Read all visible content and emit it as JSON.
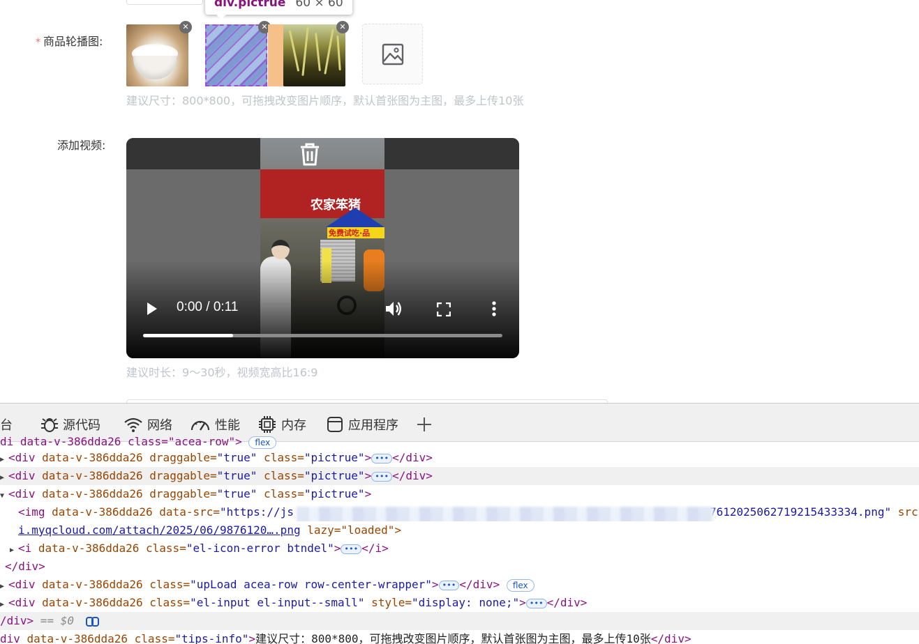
{
  "form": {
    "carousel_label": "商品轮播图:",
    "carousel_required": "*",
    "carousel_tip": "建议尺寸：800*800，可拖拽改变图片顺序，默认首张图为主图，最多上传10张",
    "video_label": "添加视频:",
    "video_tip": "建议时长：9～30秒，视频宽高比16:9"
  },
  "tooltip": {
    "tag": "div.pictrue",
    "size": "60 × 60"
  },
  "images": [
    {
      "name": "rice-bowl",
      "delete_icon": "close-icon"
    },
    {
      "name": "fabric",
      "delete_icon": "close-icon"
    },
    {
      "name": "rice-plant",
      "delete_icon": "close-icon"
    }
  ],
  "upload": {
    "icon": "image-icon"
  },
  "video": {
    "time": "0:00 / 0:11",
    "progress": 0.25,
    "sign_text": "农家笨猪",
    "banner_text": "免费试吃·品"
  },
  "devtools": {
    "tabs": [
      {
        "label": "台",
        "icon": "console-icon"
      },
      {
        "label": "源代码",
        "icon": "bug-icon"
      },
      {
        "label": "网络",
        "icon": "wifi-icon"
      },
      {
        "label": "性能",
        "icon": "gauge-icon"
      },
      {
        "label": "内存",
        "icon": "chip-icon"
      },
      {
        "label": "应用程序",
        "icon": "window-icon"
      },
      {
        "label": "+",
        "icon": "plus-icon"
      }
    ],
    "lines": {
      "l0": "di  data-v-386dda26 class=\"acea-row\">",
      "l0_badge": "flex",
      "div_open": "<div",
      "attr_v": " data-v-386dda26",
      "attr_drag": " draggable=",
      "val_true": "\"true\"",
      "attr_class": " class=",
      "val_pictrue": "\"pictrue\"",
      "gt": ">",
      "close_div": "</div>",
      "img_open": "<img",
      "attr_datasrc": " data-src=",
      "val_datasrc_start": "\"https://js",
      "val_datasrc_end": "7612025062719215433334.png\"",
      "attr_src": " src",
      "link_text": "i.myqcloud.com/attach/2025/06/9876120….png",
      "lazy_text": " lazy=\"loaded\">",
      "i_open": "<i",
      "val_btndel": "\"el-icon-error btndel\"",
      "close_i": "</i>",
      "val_upload": "\"upLoad acea-row row-center-wrapper\"",
      "badge_flex": "flex",
      "val_elinput": "\"el-input el-input--small\"",
      "attr_style": " style=",
      "val_style": "\"display: none;\"",
      "close_div_sel": "/div>",
      "eq": " == $0",
      "div_tips": "div",
      "val_tips": "\"tips-info\"",
      "tips_text": "建议尺寸：800*800，可拖拽改变图片顺序，默认首张图为主图，最多上传10张"
    }
  }
}
